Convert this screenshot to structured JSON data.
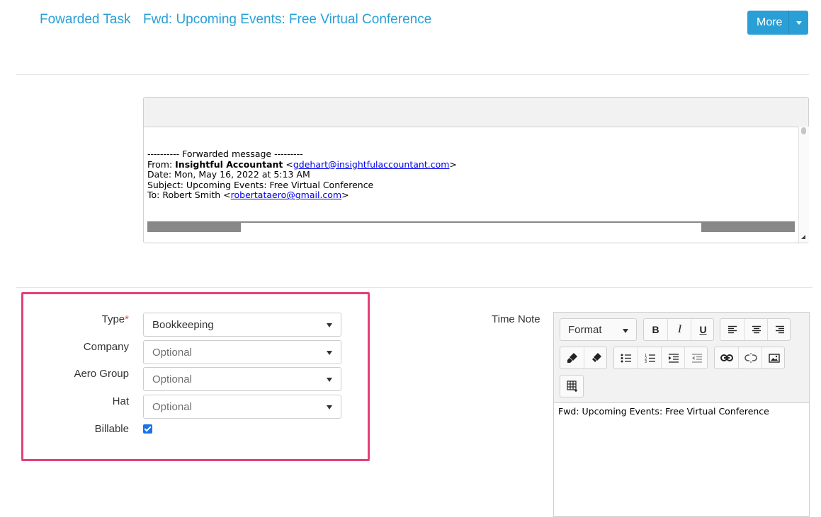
{
  "header": {
    "breadcrumb_type": "Fowarded Task",
    "breadcrumb_title": "Fwd: Upcoming Events: Free Virtual Conference",
    "more_label": "More"
  },
  "email": {
    "separator": "---------- Forwarded message ---------",
    "from_label": "From: ",
    "from_name": "Insightful Accountant",
    "from_email": "gdehart@insightfulaccountant.com",
    "date_line": "Date: Mon, May 16, 2022 at 5:13 AM",
    "subject_line": "Subject: Upcoming Events: Free Virtual Conference",
    "to_label": "To: Robert Smith ",
    "to_email": "robertataero@gmail.com"
  },
  "form": {
    "type_label": "Type",
    "type_required": "*",
    "type_value": "Bookkeeping",
    "company_label": "Company",
    "company_placeholder": "Optional",
    "aero_group_label": "Aero Group",
    "aero_group_placeholder": "Optional",
    "hat_label": "Hat",
    "hat_placeholder": "Optional",
    "billable_label": "Billable",
    "billable_checked": true
  },
  "time_note": {
    "label": "Time Note",
    "format_label": "Format",
    "bold_label": "B",
    "italic_label": "I",
    "underline_label": "U",
    "content": "Fwd: Upcoming Events: Free Virtual Conference"
  },
  "colors": {
    "accent": "#2a9fd6",
    "highlight_border": "#e4407b",
    "required": "#d9534f"
  }
}
